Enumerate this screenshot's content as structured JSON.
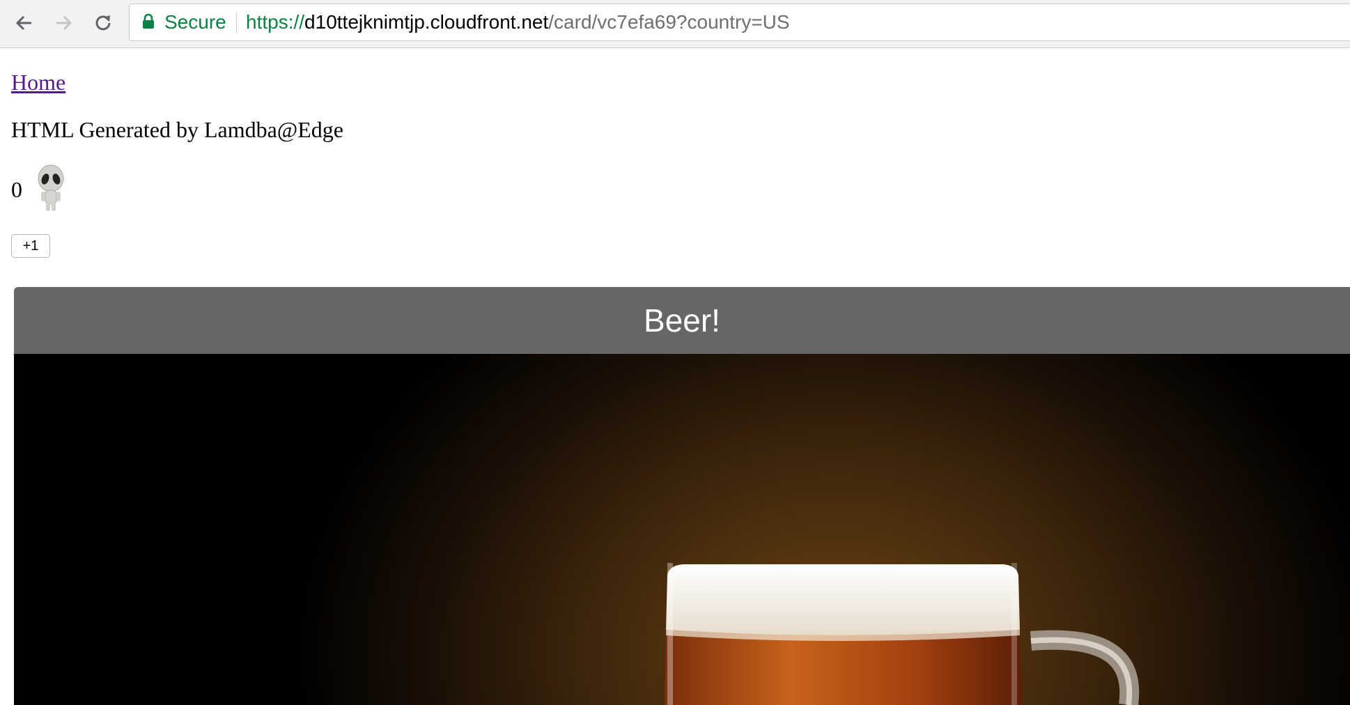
{
  "browser": {
    "secure_label": "Secure",
    "url_scheme": "https://",
    "url_host": "d10ttejknimtjp.cloudfront.net",
    "url_path": "/card/vc7efa69?country=US"
  },
  "page": {
    "home_link": "Home",
    "generated_text": "HTML Generated by Lamdba@Edge",
    "counter_value": "0",
    "plus_button_label": "+1"
  },
  "card": {
    "title": "Beer!"
  },
  "colors": {
    "secure_green": "#0b8043",
    "visited_link": "#551a8b",
    "card_header": "#666666"
  }
}
